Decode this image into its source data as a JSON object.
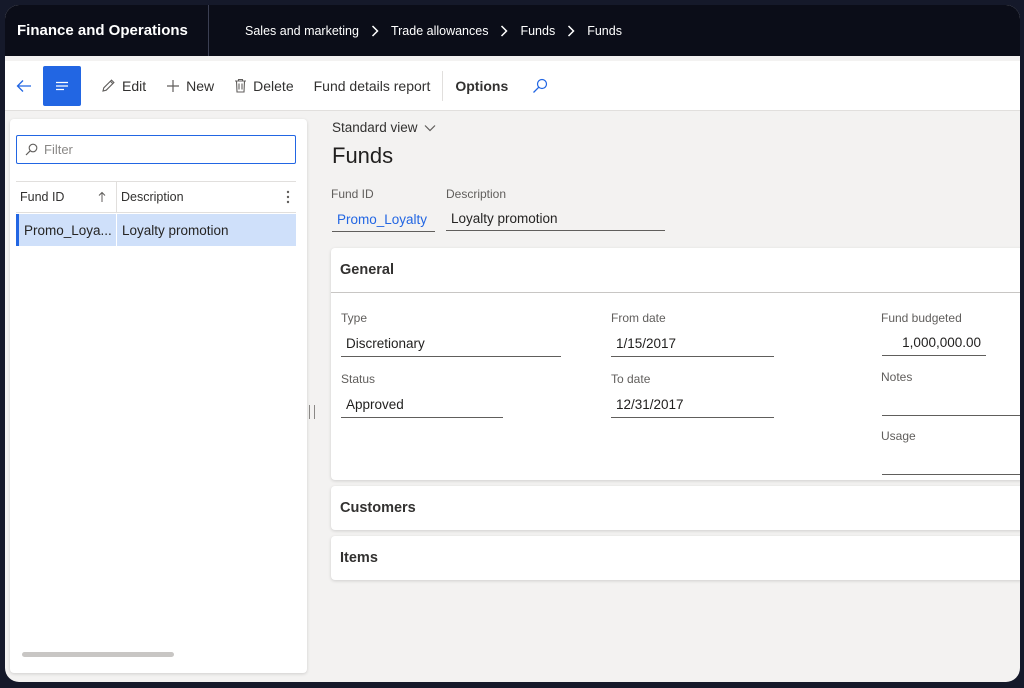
{
  "app": {
    "title": "Finance and Operations"
  },
  "breadcrumb": [
    "Sales and marketing",
    "Trade allowances",
    "Funds",
    "Funds"
  ],
  "actions": {
    "edit": "Edit",
    "new": "New",
    "delete": "Delete",
    "report": "Fund details report",
    "options": "Options"
  },
  "list": {
    "filter_placeholder": "Filter",
    "columns": [
      "Fund ID",
      "Description"
    ],
    "rows": [
      {
        "fund_id": "Promo_Loya...",
        "description": "Loyalty promotion"
      }
    ]
  },
  "details": {
    "view": "Standard view",
    "title": "Funds",
    "fund_id_label": "Fund ID",
    "fund_id": "Promo_Loyalty",
    "description_label": "Description",
    "description": "Loyalty promotion"
  },
  "general": {
    "title": "General",
    "type_label": "Type",
    "type": "Discretionary",
    "status_label": "Status",
    "status": "Approved",
    "from_date_label": "From date",
    "from_date": "1/15/2017",
    "to_date_label": "To date",
    "to_date": "12/31/2017",
    "budget_label": "Fund budgeted",
    "budget": "1,000,000.00",
    "notes_label": "Notes",
    "notes": "",
    "usage_label": "Usage",
    "usage": ""
  },
  "sections": {
    "customers": "Customers",
    "items": "Items"
  },
  "colors": {
    "accent": "#2266e3",
    "topbar": "#0b0d18",
    "selected_row": "#cfe0fa"
  }
}
